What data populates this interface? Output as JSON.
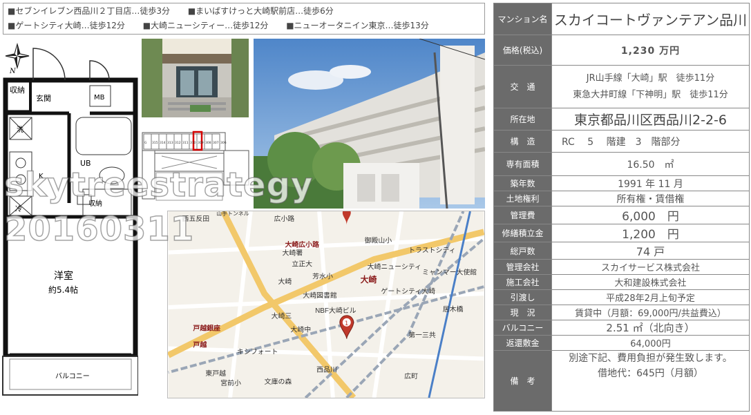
{
  "nearby": {
    "row1": [
      "■セブンイレブン西品川２丁目店…徒歩3分",
      "■まいばすけっと大崎駅前店…徒歩6分"
    ],
    "row2": [
      "■ゲートシティ大崎…徒歩12分",
      "■大崎ニューシティー…徒歩12分",
      "■ニューオータニイン東京…徒歩13分"
    ]
  },
  "watermark": {
    "line1": "skytreestrategy",
    "line2": "20160311"
  },
  "floorplan": {
    "compass": "N",
    "storage": "収納",
    "entrance": "玄関",
    "mb": "MB",
    "wash": "洗",
    "ub": "UB",
    "kitchen": "K",
    "fridge": "冷",
    "closet": "収納",
    "room_name": "洋室",
    "room_size": "約5.4帖",
    "balcony": "バルコニー"
  },
  "floor_diagram_units": [
    "G",
    "315",
    "314",
    "313",
    "312",
    "311",
    "310",
    "309",
    "308",
    "307",
    "306"
  ],
  "map": {
    "labels": [
      "西五反田",
      "山手トンネル",
      "広小路",
      "大崎広小路",
      "大崎署",
      "立正大",
      "御殿山小",
      "大崎ニューシティ",
      "大崎",
      "ゲートシティ大崎",
      "大崎図書館",
      "NBF大崎ビル",
      "大崎三",
      "大崎中",
      "第一三共",
      "戸越銀座",
      "戸越",
      "キシフォート",
      "東戸越",
      "宮前小",
      "文庫の森",
      "西品川",
      "広町",
      "芳水小",
      "大崎",
      "トラストシティ",
      "ミャンマー大使館",
      "居木橋"
    ],
    "pin_label": "1"
  },
  "info": {
    "name_label": "マンション名",
    "name": "スカイコートヴァンテアン品川",
    "price_label": "価格(税込)",
    "price": "1,230 万円",
    "access_label": "交　通",
    "access": [
      "JR山手線「大崎」駅　徒歩11分",
      "東急大井町線「下神明」駅　徒歩11分"
    ],
    "address_label": "所在地",
    "address": "東京都品川区西品川2-2-6",
    "structure_label": "構　造",
    "structure": "RC　 5 　階建　3　階部分",
    "area_label": "専有面積",
    "area": "16.50　㎡",
    "built_label": "築年数",
    "built": "1991 年 11 月",
    "land_label": "土地権利",
    "land": "所有権・賃借権",
    "mgmt_label": "管理費",
    "mgmt": "6,000　円",
    "repair_label": "修繕積立金",
    "repair": "1,200　円",
    "units_label": "総戸数",
    "units": "74 戸",
    "company_label": "管理会社",
    "company": "スカイサービス株式会社",
    "builder_label": "施工会社",
    "builder": "大和建設株式会社",
    "handover_label": "引渡し",
    "handover": "平成28年2月上旬予定",
    "status_label": "現　況",
    "status": "賃貸中（月額：69,000円/共益費込）",
    "balcony_label": "バルコニー",
    "balcony": "2.51 ㎡（北向き）",
    "deposit_label": "返還敷金",
    "deposit": "64,000円",
    "remarks_label": "備　考",
    "remarks": [
      "別途下記、費用負担が発生致します。",
      "借地代：645円（月額）"
    ]
  }
}
